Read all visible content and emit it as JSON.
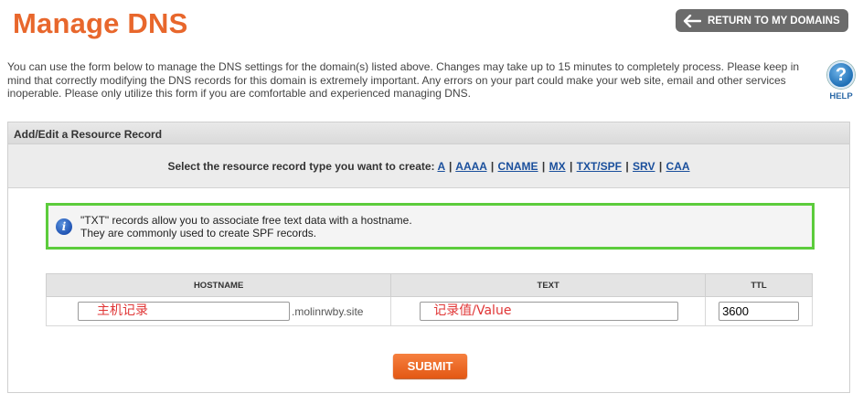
{
  "page": {
    "title": "Manage DNS",
    "return_button": "RETURN TO MY DOMAINS",
    "intro": "You can use the form below to manage the DNS settings for the domain(s) listed above. Changes may take up to 15 minutes to completely process. Please keep in mind that correctly modifying the DNS records for this domain is extremely important. Any errors on your part could make your web site, email and other services inoperable. Please only utilize this form if you are comfortable and experienced managing DNS.",
    "help": {
      "icon": "question-mark-icon",
      "label": "HELP"
    }
  },
  "panel": {
    "heading": "Add/Edit a Resource Record",
    "type_prompt": "Select the resource record type you want to create:",
    "record_types": [
      "A",
      "AAAA",
      "CNAME",
      "MX",
      "TXT/SPF",
      "SRV",
      "CAA"
    ],
    "separator": "|",
    "info": {
      "icon": "info-icon",
      "line1": "\"TXT\" records allow you to associate free text data with a hostname.",
      "line2": "They are commonly used to create SPF records."
    },
    "table": {
      "headers": {
        "hostname": "HOSTNAME",
        "text": "TEXT",
        "ttl": "TTL"
      },
      "hostname_value": "主机记录",
      "domain_suffix": ".molinrwby.site",
      "text_value": "记录值/Value",
      "ttl_value": "3600"
    },
    "submit_label": "SUBMIT"
  },
  "colors": {
    "title": "#e8672c",
    "return_button_bg": "#6b6b6b",
    "link": "#1a4f9c",
    "info_border": "#5ccc3c",
    "submit_bg": "#e35814",
    "input_text": "#e03535"
  }
}
